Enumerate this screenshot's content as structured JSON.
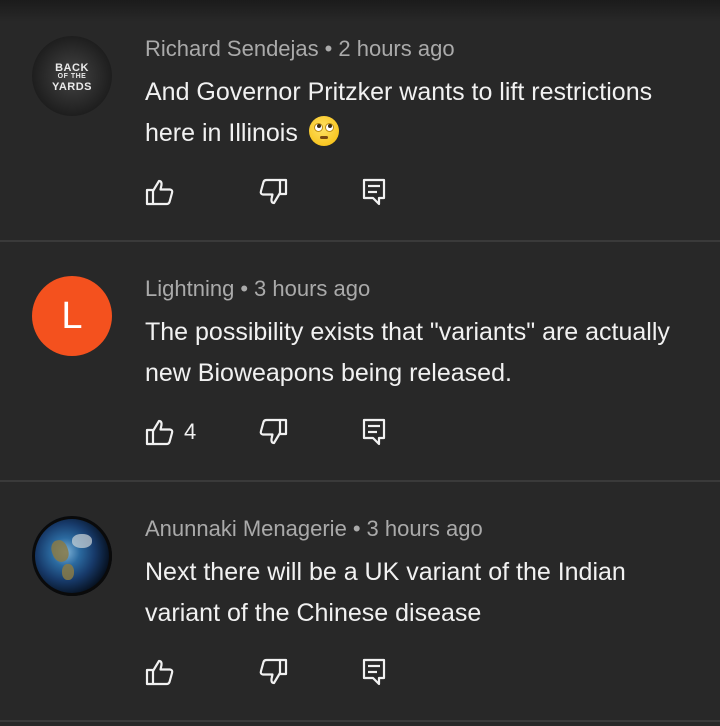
{
  "comments": [
    {
      "author": "Richard Sendejas",
      "separator": "•",
      "time": "2 hours ago",
      "text": "And Governor Pritzker wants to lift restrictions here in Illinois",
      "emoji": "face-with-rolling-eyes",
      "avatar": {
        "type": "logo",
        "lines": [
          "BACK",
          "OF THE",
          "YARDS"
        ]
      },
      "likes": ""
    },
    {
      "author": "Lightning",
      "separator": "•",
      "time": "3 hours ago",
      "text": "The possibility exists that \"variants\" are actually new Bioweapons being released.",
      "avatar": {
        "type": "letter",
        "letter": "L",
        "color": "#f4511e"
      },
      "likes": "4"
    },
    {
      "author": "Anunnaki Menagerie",
      "separator": "•",
      "time": "3 hours ago",
      "text": "Next there will be a UK variant of the Indian variant of the Chinese disease",
      "avatar": {
        "type": "image",
        "depicts": "earth-globe"
      },
      "likes": ""
    }
  ],
  "icons": {
    "like": "thumbs-up-icon",
    "dislike": "thumbs-down-icon",
    "reply": "reply-icon"
  },
  "colors": {
    "background": "#282828",
    "text": "#f1f1f1",
    "meta": "#aaaaaa",
    "divider": "#3a3a3a"
  }
}
